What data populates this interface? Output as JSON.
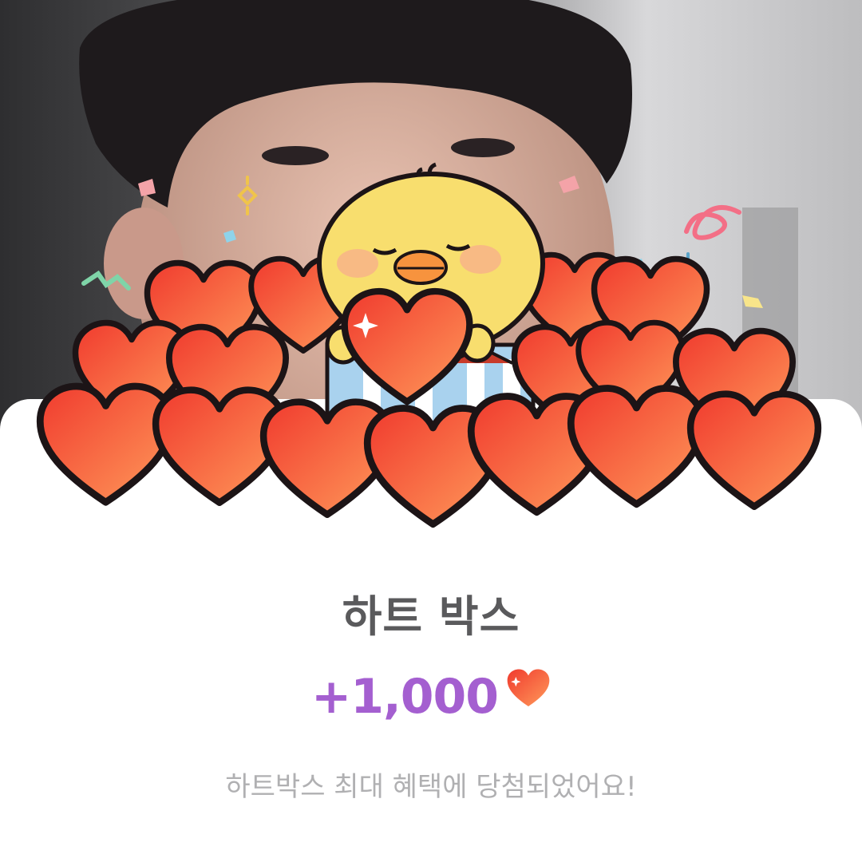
{
  "reward": {
    "title": "하트 박스",
    "amount": "+1,000",
    "currency_icon": "heart-icon",
    "message": "하트박스 최대 혜택에 당첨되었어요!"
  },
  "colors": {
    "amount": "#a45fd0",
    "title": "#5a5a5c",
    "message": "#b0b0b2",
    "heart": "#f5533d"
  }
}
